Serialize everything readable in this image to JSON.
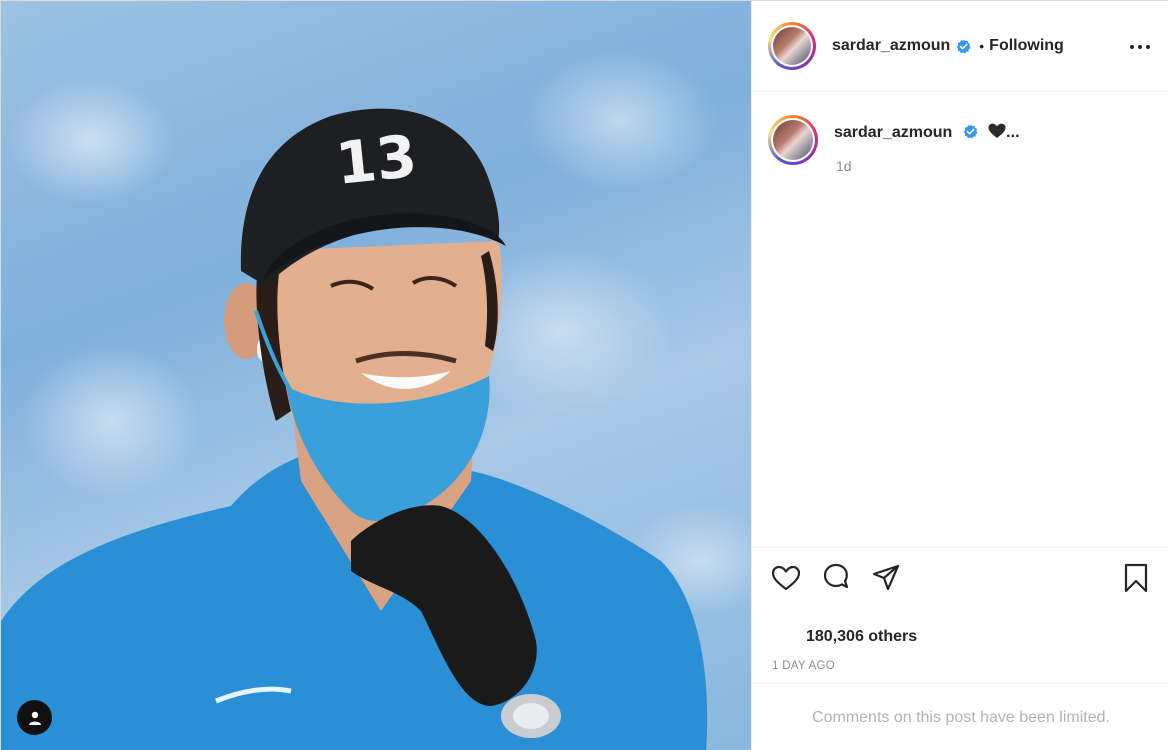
{
  "post": {
    "username": "sardar_azmoun",
    "verified_icon": "verified-badge-icon",
    "separator": "•",
    "follow_status": "Following",
    "more_icon": "more-options-icon"
  },
  "caption": {
    "username": "sardar_azmoun",
    "emoji": "black-heart-icon",
    "ellipsis": "...",
    "time": "1d"
  },
  "actions": {
    "like_icon": "heart-icon",
    "comment_icon": "comment-icon",
    "share_icon": "paper-plane-icon",
    "save_icon": "bookmark-icon"
  },
  "likes": {
    "text": "180,306 others"
  },
  "timestamp": "1 DAY AGO",
  "comments": {
    "limited_text": "Comments on this post have been limited."
  },
  "photo": {
    "tag_icon": "user-tag-icon",
    "cap_text": "13"
  },
  "colors": {
    "verified": "#3897f0",
    "shirt": "#2a8fd4",
    "mask": "#3aa0dc",
    "cap": "#1e1f22"
  }
}
